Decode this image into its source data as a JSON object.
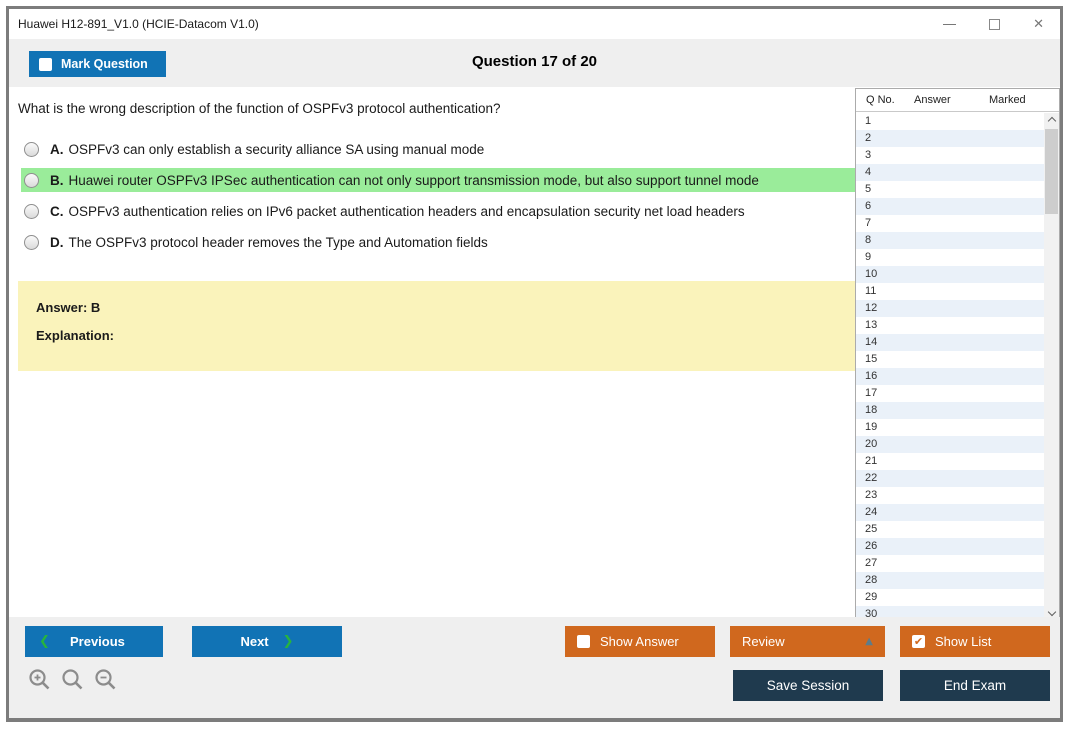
{
  "window": {
    "title": "Huawei H12-891_V1.0 (HCIE-Datacom V1.0)"
  },
  "icons": {
    "close": "✕",
    "check": "✔",
    "chevron_left": "❮",
    "chevron_right": "❯",
    "caret_up": "▲"
  },
  "header": {
    "mark_question_label": "Mark Question",
    "question_counter": "Question 17 of 20"
  },
  "question": {
    "text": "What is the wrong description of the function of OSPFv3 protocol authentication?",
    "options": [
      {
        "letter": "A.",
        "text": "OSPFv3 can only establish a security alliance SA using manual mode",
        "highlighted": false
      },
      {
        "letter": "B.",
        "text": "Huawei router OSPFv3 IPSec authentication can not only support transmission mode, but also support tunnel mode",
        "highlighted": true
      },
      {
        "letter": "C.",
        "text": "OSPFv3 authentication relies on IPv6 packet authentication headers and encapsulation security net load headers",
        "highlighted": false
      },
      {
        "letter": "D.",
        "text": "The OSPFv3 protocol header removes the Type and Automation fields",
        "highlighted": false
      }
    ],
    "answer_label": "Answer: B",
    "explanation_label": "Explanation:"
  },
  "question_list": {
    "columns": [
      "Q No.",
      "Answer",
      "Marked"
    ],
    "rows": [
      "1",
      "2",
      "3",
      "4",
      "5",
      "6",
      "7",
      "8",
      "9",
      "10",
      "11",
      "12",
      "13",
      "14",
      "15",
      "16",
      "17",
      "18",
      "19",
      "20",
      "21",
      "22",
      "23",
      "24",
      "25",
      "26",
      "27",
      "28",
      "29",
      "30"
    ]
  },
  "footer": {
    "previous_label": "Previous",
    "next_label": "Next",
    "show_answer_label": "Show Answer",
    "review_label": "Review",
    "show_list_label": "Show List",
    "save_session_label": "Save Session",
    "end_exam_label": "End Exam"
  },
  "colors": {
    "accent_blue": "#1173b5",
    "accent_orange": "#d0681e",
    "dark_navy": "#1f3a4e",
    "highlight_green": "#9aec9a",
    "answer_yellow": "#faf3bb",
    "row_alt_blue": "#eaf1f9",
    "chevron_green": "#27b43e"
  }
}
